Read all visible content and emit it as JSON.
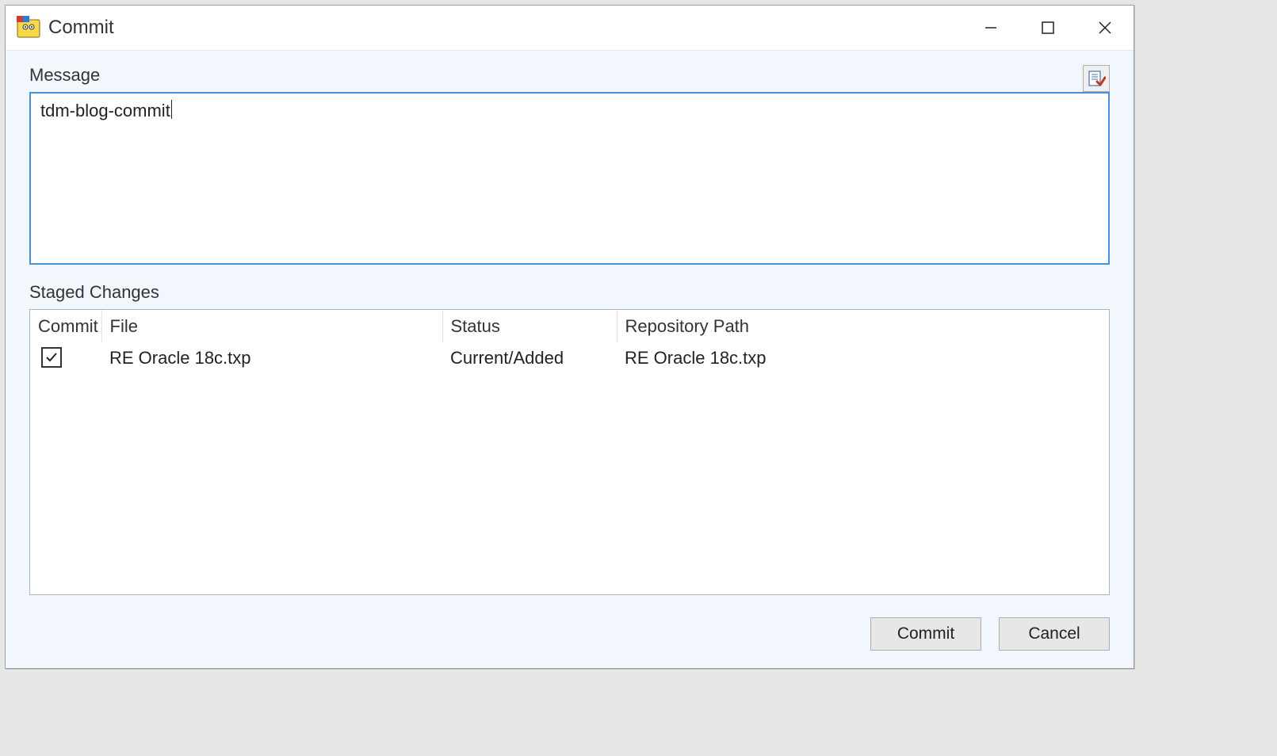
{
  "window": {
    "title": "Commit"
  },
  "labels": {
    "message": "Message",
    "staged_changes": "Staged Changes"
  },
  "message_text": "tdm-blog-commit",
  "columns": {
    "commit": "Commit",
    "file": "File",
    "status": "Status",
    "repo_path": "Repository Path"
  },
  "rows": [
    {
      "checked": true,
      "file": "RE Oracle 18c.txp",
      "status": "Current/Added",
      "repo_path": "RE Oracle 18c.txp"
    }
  ],
  "buttons": {
    "commit": "Commit",
    "cancel": "Cancel"
  }
}
